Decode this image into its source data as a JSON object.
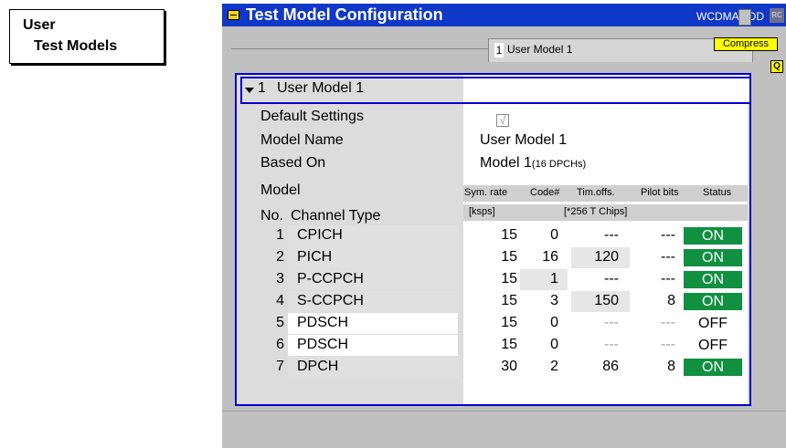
{
  "side_label": {
    "line1": "User",
    "line2": "Test Models"
  },
  "window": {
    "title": "Test Model Configuration",
    "mode": "WCDMA FDD",
    "corner": "RC"
  },
  "tab": {
    "number": "1",
    "label": "User Model 1"
  },
  "q_button": "Q",
  "compress_button": "Compress",
  "header": {
    "number": "1",
    "name": "User Model 1"
  },
  "fields": {
    "default_settings": "Default Settings",
    "default_checked": "√",
    "model_name_label": "Model Name",
    "model_name_value": "User Model 1",
    "based_on_label": "Based On",
    "based_on_value": "Model 1",
    "based_on_detail": "(16  DPCHs)",
    "model_label": "Model"
  },
  "table": {
    "no_label": "No.",
    "type_label": "Channel Type",
    "columns": [
      "Sym. rate",
      "Code#",
      "Tim.offs.",
      "Pilot bits",
      "Status"
    ],
    "units": {
      "sym": "[ksps]",
      "chips": "[*256 T Chips]"
    },
    "rows": [
      {
        "no": "1",
        "type": "CPICH",
        "sym": "15",
        "code": "0",
        "tim": "---",
        "pilot": "---",
        "status": "ON"
      },
      {
        "no": "2",
        "type": "PICH",
        "sym": "15",
        "code": "16",
        "tim": "120",
        "pilot": "---",
        "status": "ON"
      },
      {
        "no": "3",
        "type": "P-CCPCH",
        "sym": "15",
        "code": "1",
        "tim": "---",
        "pilot": "---",
        "status": "ON"
      },
      {
        "no": "4",
        "type": "S-CCPCH",
        "sym": "15",
        "code": "3",
        "tim": "150",
        "pilot": "8",
        "status": "ON"
      },
      {
        "no": "5",
        "type": "PDSCH",
        "sym": "15",
        "code": "0",
        "tim": "---",
        "pilot": "---",
        "status": "OFF"
      },
      {
        "no": "6",
        "type": "PDSCH",
        "sym": "15",
        "code": "0",
        "tim": "---",
        "pilot": "---",
        "status": "OFF"
      },
      {
        "no": "7",
        "type": "DPCH",
        "sym": "30",
        "code": "2",
        "tim": "86",
        "pilot": "8",
        "status": "ON"
      }
    ]
  },
  "colors": {
    "title_bar": "#1038c8",
    "frame": "#0000c8",
    "status_on": "#109040",
    "highlight": "#ffff00"
  }
}
